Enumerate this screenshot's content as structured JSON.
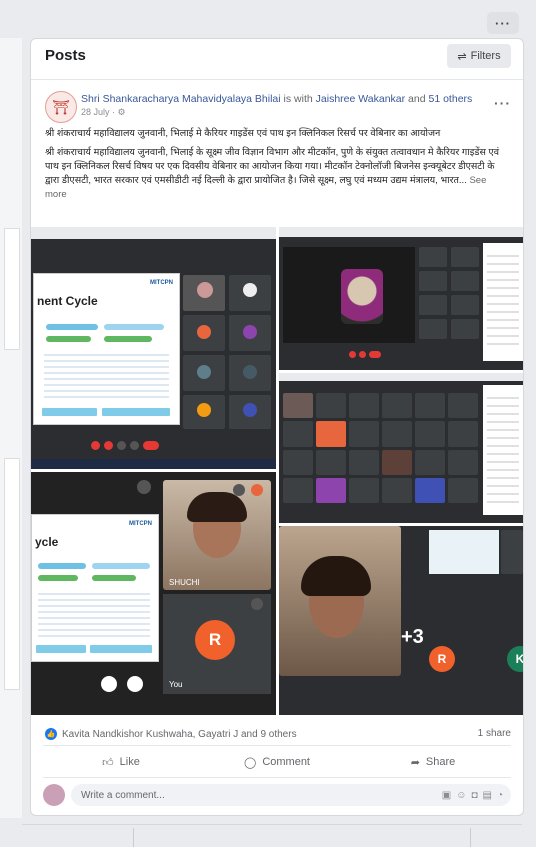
{
  "top_more": {
    "label": "···"
  },
  "section": {
    "title": "Posts",
    "filters_label": "Filters",
    "filters_icon": "sliders-icon"
  },
  "post": {
    "author": "Shri Shankaracharya Mahavidyalaya Bhilai",
    "with_text": "is with",
    "tagged": "Jaishree Wakankar",
    "and_text": "and",
    "others": "51 others",
    "date": "28 July ·",
    "title_line": "श्री शंकराचार्य महाविद्यालय जुनवानी, भिलाई मे कैरियर गाइडेंस एवं पाथ इन क्लिनिकल रिसर्च पर वेबिनार का आयोजन",
    "body": "श्री शंकराचार्य महाविद्यालय जुनवानी, भिलाई के सूक्ष्म जीव विज्ञान विभाग और मीटकॉन, पुणे के संयुक्त तत्वावधान मे कैरियर गाइडेंस एवं पाथ इन क्लिनिकल रिसर्च विषय पर एक दिवसीय वेबिनार का आयोजन किया गया। मीटकॉन टेक्नोलॉजी बिजनेस इन्क्यूबेटर डीएसटी के द्वारा डीएसटी, भारत सरकार एवं एमसीडीटी नई दिल्ली के द्वारा प्रायोजित है। जिसे सूक्ष्म, लघु एवं मध्यम उद्यम मंत्रालय, भारत...",
    "see_more": "See more"
  },
  "media": {
    "slide1_heading": "nent Cycle",
    "slide2_heading": "ycle",
    "logo_text": "MITCPN",
    "participant_name": "SHUCHI",
    "r_avatar_letter": "R",
    "you_label": "You",
    "plus_count": "+3",
    "k_avatar_letter": "K"
  },
  "reactions": {
    "text": "Kavita Nandkishor Kushwaha, Gayatri J and 9 others",
    "shares": "1 share"
  },
  "actions": {
    "like": "Like",
    "comment": "Comment",
    "share": "Share"
  },
  "comment": {
    "placeholder": "Write a comment..."
  },
  "colors": {
    "accent": "#1877f2",
    "r_avatar": "#f0612c",
    "meeting_bg": "#2b2d31"
  }
}
